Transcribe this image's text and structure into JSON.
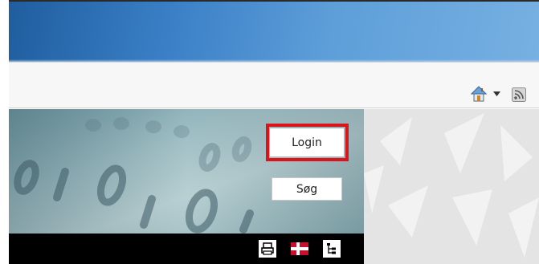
{
  "colors": {
    "banner_blue": "#3a7fc6",
    "highlight_red": "#d9141b",
    "toolbar_bg": "#f7f7f7",
    "footer_bar": "#000000",
    "right_panel_bg": "#e4e4e4"
  },
  "toolbar": {
    "home_icon": "home-icon",
    "dropdown_icon": "chevron-down-icon",
    "rss_icon": "rss-icon"
  },
  "hero": {
    "login_label": "Login",
    "search_label": "Søg"
  },
  "footer_icons": [
    "print-icon",
    "danish-flag-icon",
    "sitemap-icon"
  ]
}
